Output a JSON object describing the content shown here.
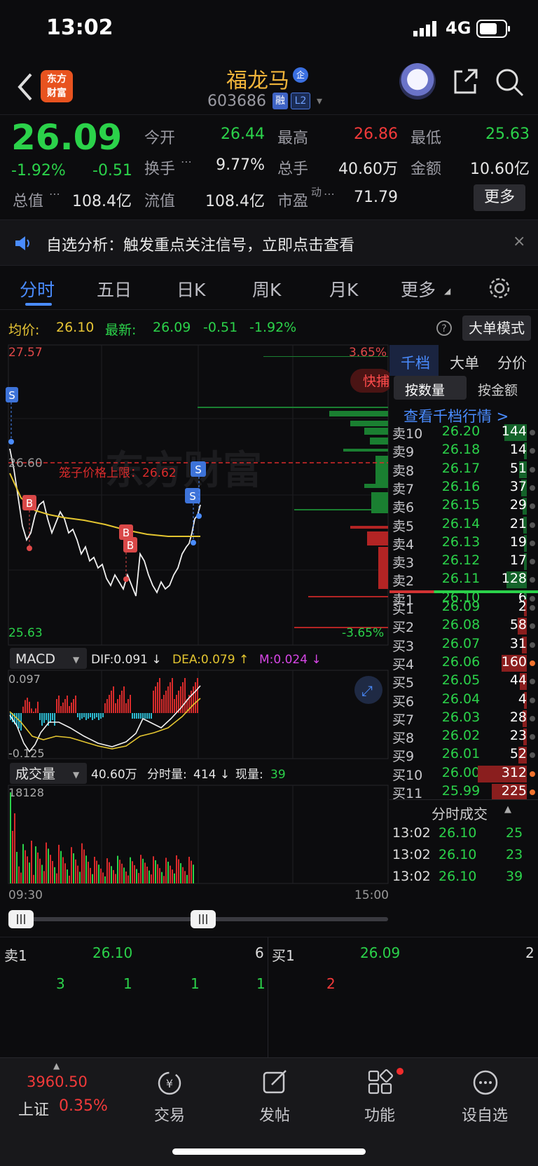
{
  "status_bar": {
    "time": "13:02",
    "network": "4G"
  },
  "header": {
    "logo_text": [
      "东方",
      "财富"
    ],
    "stock_name": "福龙马",
    "ent_badge": "企",
    "stock_code": "603686",
    "rong_badge": "融",
    "level_badge": "L2"
  },
  "quote": {
    "last_price": "26.09",
    "change_pct": "-1.92%",
    "change_amt": "-0.51",
    "open_label": "今开",
    "open": "26.44",
    "high_label": "最高",
    "high": "26.86",
    "low_label": "最低",
    "low": "25.63",
    "turnover_label": "换手",
    "turnover": "9.77%",
    "volume_label": "总手",
    "volume": "40.60万",
    "amount_label": "金额",
    "amount": "10.60亿",
    "total_mv_label": "总值",
    "total_mv": "108.4亿",
    "float_mv_label": "流值",
    "float_mv": "108.4亿",
    "pe_label": "市盈",
    "pe_sup": "动",
    "pe": "71.79",
    "more_label": "更多"
  },
  "notice": {
    "text": "自选分析：触发重点关注信号，立即点击查看",
    "close": "×"
  },
  "tabs": [
    {
      "label": "分时"
    },
    {
      "label": "五日"
    },
    {
      "label": "日K"
    },
    {
      "label": "周K"
    },
    {
      "label": "月K"
    },
    {
      "label": "更多"
    }
  ],
  "avg_bar": {
    "avg_label": "均价:",
    "avg": "26.10",
    "latest_label": "最新:",
    "latest": "26.09",
    "latest_chg": "-0.51",
    "latest_pct": "-1.92%",
    "big_order_label": "大单模式"
  },
  "chart": {
    "price_top": "27.57",
    "price_mid": "26.60",
    "price_bottom": "25.63",
    "pct_top": "3.65%",
    "pct_bottom": "-3.65%",
    "limit_label": "笼子价格上限：26.62",
    "quick_label": "快捕",
    "watermark": "东方财富",
    "macd_label": "MACD",
    "dif": "DIF:0.091 ↓",
    "dea": "DEA:0.079 ↑",
    "m": "M:0.024 ↓",
    "macd_top": "0.097",
    "macd_bottom": "-0.125",
    "vol_label": "成交量",
    "vol_total": "40.60万",
    "vol_min_label": "分时量:",
    "vol_min": "414 ↓",
    "vol_now_label": "现量:",
    "vol_now": "39",
    "vol_max": "18128",
    "time_start": "09:30",
    "time_end": "15:00",
    "markers": [
      "S",
      "B",
      "B",
      "B",
      "S",
      "S"
    ]
  },
  "right_panel": {
    "tabs": [
      "千档",
      "大单",
      "分价"
    ],
    "subtabs": [
      "按数量",
      "按金额"
    ],
    "depth_link": "查看千档行情 >",
    "asks": [
      {
        "label": "卖10",
        "price": "26.20",
        "qty": "144"
      },
      {
        "label": "卖9",
        "price": "26.18",
        "qty": "14"
      },
      {
        "label": "卖8",
        "price": "26.17",
        "qty": "51"
      },
      {
        "label": "卖7",
        "price": "26.16",
        "qty": "37"
      },
      {
        "label": "卖6",
        "price": "26.15",
        "qty": "29"
      },
      {
        "label": "卖5",
        "price": "26.14",
        "qty": "21"
      },
      {
        "label": "卖4",
        "price": "26.13",
        "qty": "19"
      },
      {
        "label": "卖3",
        "price": "26.12",
        "qty": "17"
      },
      {
        "label": "卖2",
        "price": "26.11",
        "qty": "128"
      },
      {
        "label": "卖1",
        "price": "26.10",
        "qty": "6"
      }
    ],
    "bids": [
      {
        "label": "买1",
        "price": "26.09",
        "qty": "2"
      },
      {
        "label": "买2",
        "price": "26.08",
        "qty": "58"
      },
      {
        "label": "买3",
        "price": "26.07",
        "qty": "31"
      },
      {
        "label": "买4",
        "price": "26.06",
        "qty": "160"
      },
      {
        "label": "买5",
        "price": "26.05",
        "qty": "44"
      },
      {
        "label": "买6",
        "price": "26.04",
        "qty": "4"
      },
      {
        "label": "买7",
        "price": "26.03",
        "qty": "28"
      },
      {
        "label": "买8",
        "price": "26.02",
        "qty": "23"
      },
      {
        "label": "买9",
        "price": "26.01",
        "qty": "52"
      },
      {
        "label": "买10",
        "price": "26.00",
        "qty": "312"
      },
      {
        "label": "买11",
        "price": "25.99",
        "qty": "225"
      }
    ],
    "ticks_title": "分时成交",
    "ticks": [
      {
        "time": "13:02",
        "price": "26.10",
        "qty": "25"
      },
      {
        "time": "13:02",
        "price": "26.10",
        "qty": "23"
      },
      {
        "time": "13:02",
        "price": "26.10",
        "qty": "39"
      }
    ]
  },
  "strip": {
    "ask_label": "卖1",
    "ask_price": "26.10",
    "ask_qty": "6",
    "bid_label": "买1",
    "bid_price": "26.09",
    "bid_qty": "2",
    "ask_queue": [
      "3",
      "1",
      "1",
      "1"
    ],
    "bid_queue": [
      "2"
    ]
  },
  "bottom_nav": {
    "index_value": "3960.50",
    "index_name": "上证",
    "index_pct": "0.35%",
    "items": [
      {
        "label": "交易",
        "icon": "trade-icon"
      },
      {
        "label": "发帖",
        "icon": "post-icon"
      },
      {
        "label": "功能",
        "icon": "function-icon"
      },
      {
        "label": "设自选",
        "icon": "add-watchlist-icon"
      }
    ]
  }
}
